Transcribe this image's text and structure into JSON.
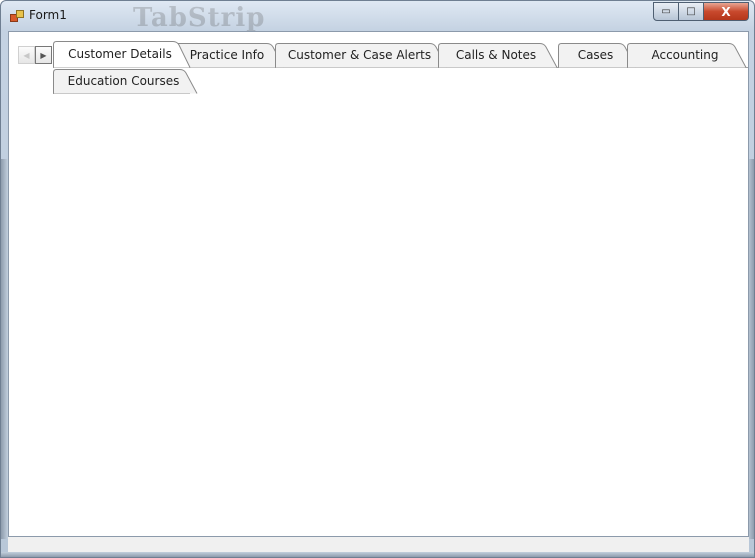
{
  "window": {
    "title": "Form1",
    "watermark": "TabStrip"
  },
  "caption": {
    "minimize": "▭",
    "maximize": "□",
    "close": "X"
  },
  "scroll": {
    "left_arrow": "◀",
    "right_arrow": "▶"
  },
  "tabs": {
    "row1": [
      {
        "label": "Customer Details",
        "active": true
      },
      {
        "label": "Practice Info",
        "active": false
      },
      {
        "label": "Customer & Case Alerts",
        "active": false
      },
      {
        "label": "Calls & Notes",
        "active": false
      },
      {
        "label": "Cases",
        "active": false
      },
      {
        "label": "Accounting",
        "active": false
      }
    ],
    "row2": [
      {
        "label": "Education Courses",
        "active": false
      }
    ]
  }
}
